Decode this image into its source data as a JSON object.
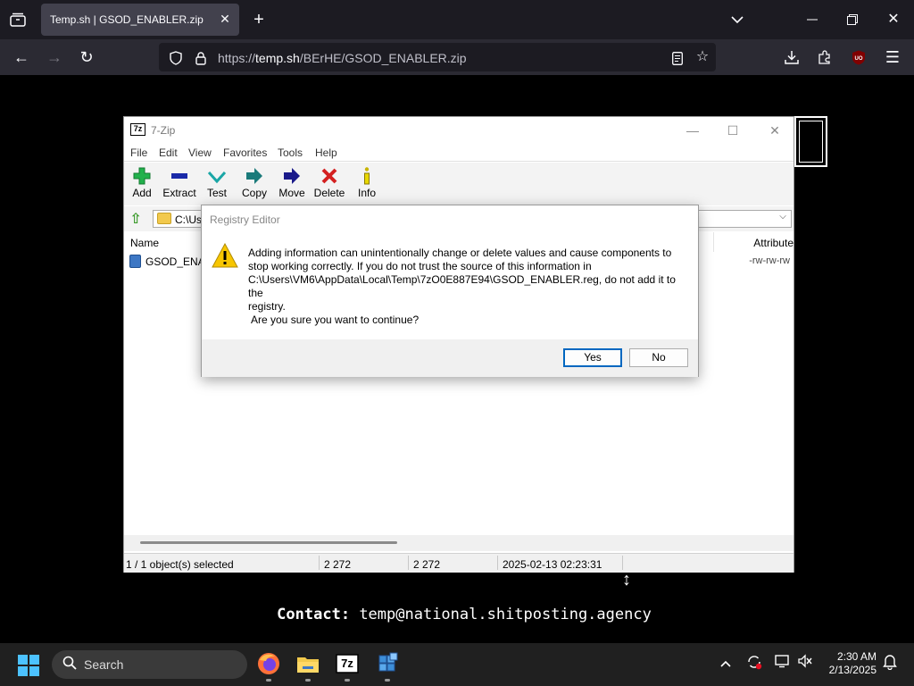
{
  "browser": {
    "tab_title": "Temp.sh | GSOD_ENABLER.zip",
    "url_prefix": "https://",
    "url_host": "temp.sh",
    "url_path": "/BErHE/GSOD_ENABLER.zip"
  },
  "zip_window": {
    "title": "7-Zip",
    "logo_text": "7z",
    "menu": [
      "File",
      "Edit",
      "View",
      "Favorites",
      "Tools",
      "Help"
    ],
    "toolbar": [
      {
        "label": "Add",
        "icon": "plus-icon",
        "color": "#22b14c"
      },
      {
        "label": "Extract",
        "icon": "minus-icon",
        "color": "#1a2aa8"
      },
      {
        "label": "Test",
        "icon": "check-icon",
        "color": "#1aa6a6"
      },
      {
        "label": "Copy",
        "icon": "copy-arrow-icon",
        "color": "#1a7a7a"
      },
      {
        "label": "Move",
        "icon": "move-arrow-icon",
        "color": "#1a1a8a"
      },
      {
        "label": "Delete",
        "icon": "delete-x-icon",
        "color": "#d42020"
      },
      {
        "label": "Info",
        "icon": "info-icon",
        "color": "#c8b400"
      }
    ],
    "address": "C:\\Use",
    "columns": {
      "name": "Name",
      "attributes": "Attribute"
    },
    "file": {
      "name": "GSOD_ENAB",
      "attributes": "-rw-rw-rw"
    },
    "status": {
      "selected": "1 / 1 object(s) selected",
      "size": "2 272",
      "packed": "2 272",
      "modified": "2025-02-13 02:23:31"
    }
  },
  "registry_dialog": {
    "title": "Registry Editor",
    "message_lines": [
      "Adding information can unintentionally change or delete values and cause components to",
      "stop working correctly. If you do not trust the source of this information in",
      "C:\\Users\\VM6\\AppData\\Local\\Temp\\7zO0E887E94\\GSOD_ENABLER.reg, do not add it to the",
      "registry."
    ],
    "question": "Are you sure you want to continue?",
    "yes_label": "Yes",
    "no_label": "No"
  },
  "contact": {
    "label": "Contact:",
    "email": "temp@national.shitposting.agency"
  },
  "taskbar": {
    "search_label": "Search",
    "seven_zip_label": "7z",
    "time": "2:30 AM",
    "date": "2/13/2025"
  }
}
